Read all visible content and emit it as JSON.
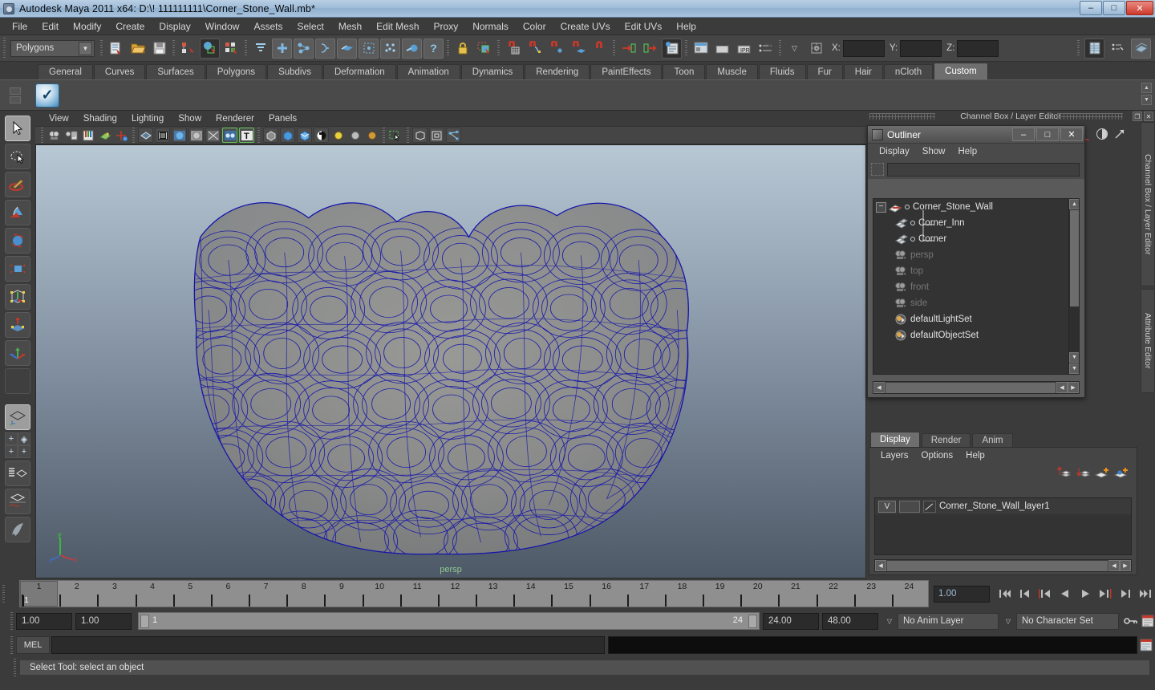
{
  "window": {
    "title": "Autodesk Maya 2011 x64: D:\\! 111111111\\Corner_Stone_Wall.mb*",
    "minimize": "–",
    "maximize": "□",
    "close": "✕"
  },
  "menubar": {
    "items": [
      "File",
      "Edit",
      "Modify",
      "Create",
      "Display",
      "Window",
      "Assets",
      "Select",
      "Mesh",
      "Edit Mesh",
      "Proxy",
      "Normals",
      "Color",
      "Create UVs",
      "Edit UVs",
      "Help"
    ]
  },
  "toolbar": {
    "menu_set": "Polygons",
    "coords": [
      {
        "label": "X:",
        "value": ""
      },
      {
        "label": "Y:",
        "value": ""
      },
      {
        "label": "Z:",
        "value": ""
      }
    ]
  },
  "shelf": {
    "tabs": [
      "General",
      "Curves",
      "Surfaces",
      "Polygons",
      "Subdivs",
      "Deformation",
      "Animation",
      "Dynamics",
      "Rendering",
      "PaintEffects",
      "Toon",
      "Muscle",
      "Fluids",
      "Fur",
      "Hair",
      "nCloth",
      "Custom"
    ],
    "active_tab": "Custom"
  },
  "viewport": {
    "menus": [
      "View",
      "Shading",
      "Lighting",
      "Show",
      "Renderer",
      "Panels"
    ],
    "camera_label": "persp",
    "axis": {
      "x": "x",
      "y": "y",
      "z": "z"
    }
  },
  "channelbox": {
    "title": "Channel Box / Layer Editor",
    "side_tabs": [
      "Channel Box / Layer Editor",
      "Attribute Editor"
    ]
  },
  "outliner": {
    "title": "Outliner",
    "window_buttons": {
      "minimize": "–",
      "maximize": "□",
      "close": "✕"
    },
    "menus": [
      "Display",
      "Show",
      "Help"
    ],
    "search_value": "",
    "search_placeholder": "",
    "items": [
      {
        "label": "Corner_Stone_Wall",
        "icon": "transform-icon",
        "depth": 0,
        "expander": "−",
        "dim": false
      },
      {
        "label": "Corner_Inn",
        "icon": "mesh-icon",
        "depth": 1,
        "expander": "",
        "dim": false
      },
      {
        "label": "Corner",
        "icon": "mesh-icon",
        "depth": 1,
        "expander": "",
        "dim": false
      },
      {
        "label": "persp",
        "icon": "camera-icon",
        "depth": 0,
        "expander": "",
        "dim": true
      },
      {
        "label": "top",
        "icon": "camera-icon",
        "depth": 0,
        "expander": "",
        "dim": true
      },
      {
        "label": "front",
        "icon": "camera-icon",
        "depth": 0,
        "expander": "",
        "dim": true
      },
      {
        "label": "side",
        "icon": "camera-icon",
        "depth": 0,
        "expander": "",
        "dim": true
      },
      {
        "label": "defaultLightSet",
        "icon": "set-icon",
        "depth": 0,
        "expander": "",
        "dim": false
      },
      {
        "label": "defaultObjectSet",
        "icon": "set-icon",
        "depth": 0,
        "expander": "",
        "dim": false
      }
    ]
  },
  "layer_editor": {
    "tabs": [
      "Display",
      "Render",
      "Anim"
    ],
    "active_tab": "Display",
    "menus": [
      "Layers",
      "Options",
      "Help"
    ],
    "layers": [
      {
        "visibility": "V",
        "display_type": "",
        "name": "Corner_Stone_Wall_layer1"
      }
    ]
  },
  "timeline": {
    "ticks": [
      "1",
      "2",
      "3",
      "4",
      "5",
      "6",
      "7",
      "8",
      "9",
      "10",
      "11",
      "12",
      "13",
      "14",
      "15",
      "16",
      "17",
      "18",
      "19",
      "20",
      "21",
      "22",
      "23",
      "24"
    ],
    "current_frame_marker": "1",
    "current_frame_field": "1.00",
    "playback_buttons": [
      "go-to-start",
      "step-back-key",
      "step-back-frame",
      "play-backwards",
      "play-forwards",
      "step-forward-frame",
      "step-forward-key",
      "go-to-end"
    ]
  },
  "range": {
    "anim_start": "1.00",
    "range_start": "1.00",
    "slider_min_label": "1",
    "slider_max_label": "24",
    "range_end": "24.00",
    "anim_end": "48.00",
    "anim_layer": "No Anim Layer",
    "character_set": "No Character Set"
  },
  "command_line": {
    "language_label": "MEL",
    "input_value": "",
    "output_value": ""
  },
  "help_line": {
    "text": "Select Tool: select an object"
  },
  "tools": {
    "items": [
      {
        "name": "select-tool",
        "selected": true
      },
      {
        "name": "lasso-select-tool",
        "selected": false
      },
      {
        "name": "paint-select-tool",
        "selected": false
      },
      {
        "name": "move-tool",
        "selected": false
      },
      {
        "name": "rotate-tool",
        "selected": false
      },
      {
        "name": "scale-tool",
        "selected": false
      },
      {
        "name": "universal-manipulator-tool",
        "selected": false
      },
      {
        "name": "soft-modification-tool",
        "selected": false
      },
      {
        "name": "show-manipulator-tool",
        "selected": false
      },
      {
        "name": "last-tool-used",
        "selected": false
      }
    ],
    "layouts": [
      {
        "name": "single-perspective-layout",
        "selected": true
      },
      {
        "name": "four-view-layout",
        "selected": false
      },
      {
        "name": "outliner-persp-layout",
        "selected": false
      },
      {
        "name": "persp-graph-layout",
        "selected": false
      },
      {
        "name": "maya-logo",
        "selected": false
      }
    ]
  },
  "colors": {
    "wireframe": "#1414aa",
    "accent_green": "#8fc98f",
    "viewport_top": "#b8c7d4",
    "viewport_bottom": "#4e5967",
    "panel_bg": "#3b3b3b",
    "field_bg": "#2b2b2b"
  }
}
